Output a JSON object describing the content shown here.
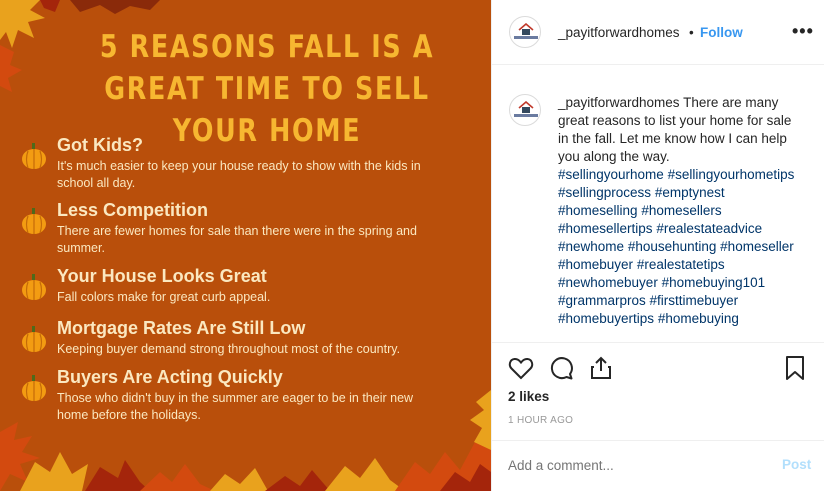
{
  "image": {
    "title": "5 REASONS FALL IS A GREAT TIME TO SELL YOUR HOME",
    "background_color": "#b94f0b",
    "title_color": "#f7b731",
    "reasons": [
      {
        "title": "Got Kids?",
        "desc": "It's much easier to keep your house ready to show with the kids in school all day."
      },
      {
        "title": "Less Competition",
        "desc": "There are fewer homes for sale than there were in the spring and summer."
      },
      {
        "title": "Your House Looks Great",
        "desc": "Fall colors make for great curb appeal."
      },
      {
        "title": "Mortgage Rates Are Still Low",
        "desc": "Keeping buyer demand strong throughout most of the country."
      },
      {
        "title": "Buyers Are Acting Quickly",
        "desc": "Those who didn't buy in the summer are eager to be in their new home before the holidays."
      }
    ]
  },
  "header": {
    "username": "_payitforwardhomes",
    "separator": "•",
    "follow_label": "Follow",
    "more_label": "•••"
  },
  "caption": {
    "username": "_payitforwardhomes",
    "text": "There are many great reasons to list your home for sale in the fall. Let me know how I can help you along the way.",
    "hashtags": [
      "#sellingyourhome",
      "#sellingyourhometips",
      "#sellingprocess",
      "#emptynest",
      "#homeselling",
      "#homesellers",
      "#homesellertips",
      "#realestateadvice",
      "#newhome",
      "#househunting",
      "#homeseller",
      "#homebuyer",
      "#realestatetips",
      "#newhomebuyer",
      "#homebuying101",
      "#grammarpros",
      "#firsttimebuyer",
      "#homebuyertips",
      "#homebuying"
    ]
  },
  "actions": {
    "icons": [
      "heart-icon",
      "comment-icon",
      "share-icon",
      "bookmark-icon"
    ],
    "likes": "2 likes",
    "timestamp": "1 HOUR AGO"
  },
  "comment": {
    "placeholder": "Add a comment...",
    "post_label": "Post"
  },
  "colors": {
    "link": "#3897f0",
    "hashtag": "#003569",
    "post_disabled": "#b2dffc"
  }
}
